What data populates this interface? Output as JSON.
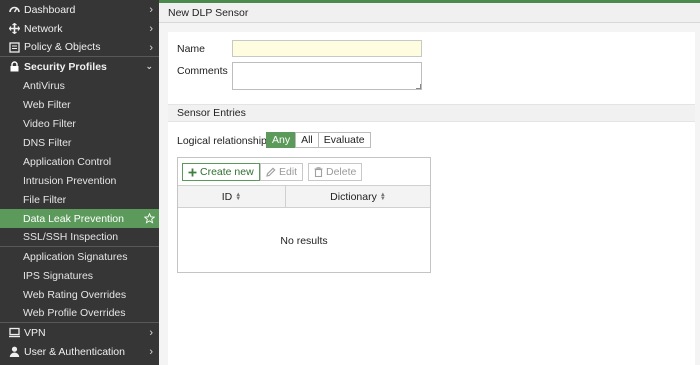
{
  "sidebar": {
    "items": [
      {
        "label": "Dashboard",
        "icon": "dashboard-icon",
        "level": "top",
        "chevron": "right"
      },
      {
        "label": "Network",
        "icon": "network-icon",
        "level": "top",
        "chevron": "right"
      },
      {
        "label": "Policy & Objects",
        "icon": "policy-icon",
        "level": "top",
        "chevron": "right"
      },
      {
        "label": "Security Profiles",
        "icon": "lock-icon",
        "level": "top",
        "chevron": "down",
        "open": true
      },
      {
        "label": "AntiVirus",
        "level": "sub"
      },
      {
        "label": "Web Filter",
        "level": "sub"
      },
      {
        "label": "Video Filter",
        "level": "sub"
      },
      {
        "label": "DNS Filter",
        "level": "sub"
      },
      {
        "label": "Application Control",
        "level": "sub"
      },
      {
        "label": "Intrusion Prevention",
        "level": "sub"
      },
      {
        "label": "File Filter",
        "level": "sub"
      },
      {
        "label": "Data Leak Prevention",
        "level": "sub",
        "active": true
      },
      {
        "label": "SSL/SSH Inspection",
        "level": "sub"
      },
      {
        "label": "Application Signatures",
        "level": "sub"
      },
      {
        "label": "IPS Signatures",
        "level": "sub"
      },
      {
        "label": "Web Rating Overrides",
        "level": "sub"
      },
      {
        "label": "Web Profile Overrides",
        "level": "sub"
      },
      {
        "label": "VPN",
        "icon": "vpn-icon",
        "level": "top",
        "chevron": "right"
      },
      {
        "label": "User & Authentication",
        "icon": "user-icon",
        "level": "top",
        "chevron": "right"
      }
    ]
  },
  "page": {
    "title": "New DLP Sensor"
  },
  "form": {
    "name_label": "Name",
    "name_value": "",
    "comments_label": "Comments",
    "comments_value": ""
  },
  "entries": {
    "section_title": "Sensor Entries",
    "logical_label": "Logical relationship",
    "logical_options": [
      "Any",
      "All",
      "Evaluate"
    ],
    "logical_selected": "Any",
    "buttons": {
      "create": "Create new",
      "edit": "Edit",
      "delete": "Delete"
    },
    "columns": [
      "ID",
      "Dictionary"
    ],
    "empty_text": "No results"
  },
  "colors": {
    "accent": "#5c9a5c",
    "sidebar": "#363636",
    "name_field_bg": "#fffde0"
  }
}
